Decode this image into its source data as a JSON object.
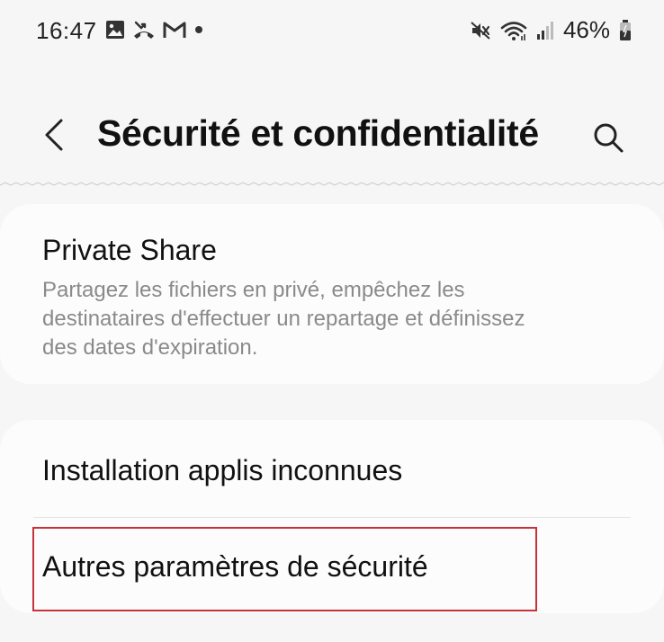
{
  "status_bar": {
    "time": "16:47",
    "battery_percent": "46%",
    "left_icons": [
      "gallery-icon",
      "missed-call-icon",
      "gmail-icon",
      "notification-dot-icon"
    ],
    "right_icons": [
      "mute-icon",
      "wifi-icon",
      "signal-icon",
      "battery-icon"
    ]
  },
  "header": {
    "title": "Sécurité et confidentialité",
    "back_icon": "chevron-left-icon",
    "search_icon": "search-icon"
  },
  "sections": {
    "private_share": {
      "title": "Private Share",
      "description_lines": [
        "Partagez les fichiers en privé, empêchez les",
        "destinataires d'effectuer un repartage et définissez",
        "des dates d'expiration."
      ]
    },
    "unknown_apps": {
      "title": "Installation applis inconnues"
    },
    "other_security": {
      "title": "Autres paramètres de sécurité"
    }
  },
  "colors": {
    "background": "#f6f6f6",
    "card": "#fcfcfc",
    "highlight": "#c8323a",
    "secondary_text": "#8a8a8a"
  }
}
